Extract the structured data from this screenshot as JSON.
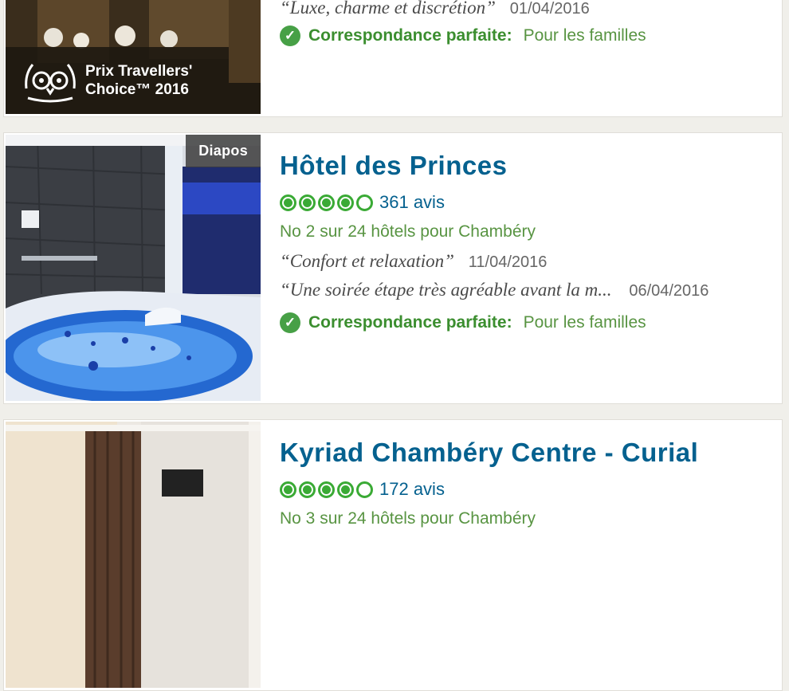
{
  "listings": [
    {
      "award": {
        "line1": "Prix Travellers'",
        "line2": "Choice™ 2016"
      },
      "reviews": [
        {
          "quote": "“Luxe, charme et discrétion”",
          "date": "01/04/2016"
        }
      ],
      "match": {
        "label": "Correspondance parfaite:",
        "value": "Pour les familles"
      }
    },
    {
      "badge": "Diapos",
      "title": "Hôtel des Princes",
      "rating": 4,
      "review_count": "361 avis",
      "ranking": "No 2 sur 24 hôtels pour Chambéry",
      "reviews": [
        {
          "quote": "“Confort et relaxation”",
          "date": "11/04/2016"
        },
        {
          "quote": "“Une soirée étape très agréable avant la m...",
          "date": "06/04/2016"
        }
      ],
      "match": {
        "label": "Correspondance parfaite:",
        "value": "Pour les familles"
      }
    },
    {
      "title": "Kyriad Chambéry Centre - Curial",
      "rating": 4,
      "review_count": "172 avis",
      "ranking": "No 3 sur 24 hôtels pour Chambéry"
    }
  ],
  "colors": {
    "title": "#05618f",
    "bubble": "#3aaa35",
    "match_green": "#3b8e2f"
  },
  "icons": {
    "check": "check-circle-icon",
    "owl": "tripadvisor-owl-icon"
  }
}
